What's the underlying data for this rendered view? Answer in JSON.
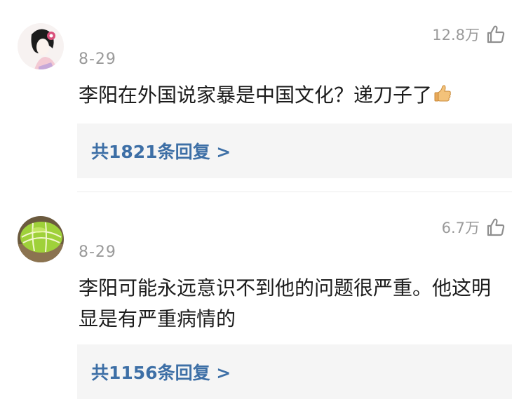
{
  "comments": [
    {
      "avatar_icon": "geisha-avatar-icon",
      "date": "8-29",
      "likes": "12.8万",
      "text": "李阳在外国说家暴是中国文化？递刀子了",
      "emoji": "thumbs-up-icon",
      "replies": "共1821条回复 >"
    },
    {
      "avatar_icon": "green-ball-avatar-icon",
      "date": "8-29",
      "likes": "6.7万",
      "text": "李阳可能永远意识不到他的问题很严重。他这明显是有严重病情的",
      "replies": "共1156条回复 >"
    }
  ],
  "colors": {
    "meta_gray": "#9a9a9a",
    "reply_blue": "#3d6fa6",
    "reply_bg": "#f5f5f5"
  }
}
